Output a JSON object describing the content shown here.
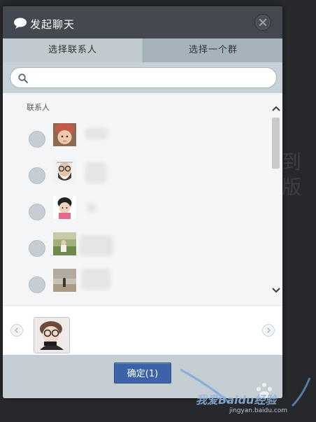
{
  "dialog": {
    "title": "发起聊天",
    "title_icon": "chat-bubble-icon",
    "close_icon": "close-icon"
  },
  "tabs": [
    {
      "label": "选择联系人",
      "active": true
    },
    {
      "label": "选择一个群",
      "active": false
    }
  ],
  "search": {
    "icon": "search-icon",
    "value": "",
    "placeholder": ""
  },
  "contacts": {
    "section_label": "联系人",
    "items": [
      {
        "avatar": "avatar-baby-hat",
        "name": "",
        "selected": false
      },
      {
        "avatar": "avatar-bearded-man",
        "name": "",
        "selected": false
      },
      {
        "avatar": "avatar-toddler-pink",
        "name": "",
        "selected": false
      },
      {
        "avatar": "avatar-child-grass",
        "name": "",
        "selected": false
      },
      {
        "avatar": "avatar-beach-person",
        "name": "",
        "selected": false
      },
      {
        "avatar": "avatar-partial",
        "name": "",
        "selected": false
      }
    ]
  },
  "selected_bar": {
    "prev_icon": "chevron-left-icon",
    "next_icon": "chevron-right-icon",
    "selected_avatar": "avatar-girl-glasses"
  },
  "footer": {
    "confirm_label": "确定(1)"
  },
  "background": {
    "glyphs": [
      "到",
      "版"
    ]
  },
  "watermark": {
    "text": "我爱Baidu经验",
    "url": "jingyan.baidu.com"
  },
  "colors": {
    "titlebar": "#43494f",
    "tab_active": "#c1cacf",
    "tab_inactive": "#a7b3ba",
    "confirm_button": "#3c62a8",
    "page_background": "#26282b"
  }
}
